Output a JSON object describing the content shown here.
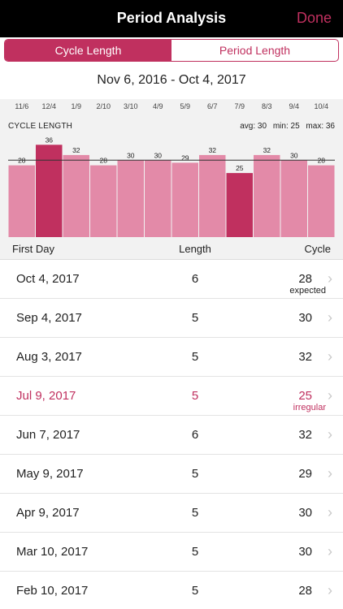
{
  "nav": {
    "title": "Period Analysis",
    "done_label": "Done"
  },
  "tabs": [
    {
      "label": "Cycle Length",
      "active": true
    },
    {
      "label": "Period Length",
      "active": false
    }
  ],
  "date_range": "Nov 6, 2016 - Oct 4, 2017",
  "chart_data": {
    "type": "bar",
    "title": "CYCLE LENGTH",
    "stats": {
      "avg": "avg: 30",
      "min": "min: 25",
      "max": "max: 36"
    },
    "average": 30,
    "categories": [
      "11/6",
      "12/4",
      "1/9",
      "2/10",
      "3/10",
      "4/9",
      "5/9",
      "6/7",
      "7/9",
      "8/3",
      "9/4",
      "10/4"
    ],
    "values": [
      28,
      36,
      32,
      28,
      30,
      30,
      29,
      32,
      25,
      32,
      30,
      28
    ],
    "highlighted": [
      1,
      8
    ],
    "colors": {
      "normal": "#e38aa8",
      "highlight": "#c0305f",
      "average_line": "#333333"
    }
  },
  "list_header": {
    "first_day": "First Day",
    "length": "Length",
    "cycle": "Cycle"
  },
  "rows": [
    {
      "date": "Oct 4, 2017",
      "length": "6",
      "cycle": "28",
      "note": "expected",
      "highlight": false
    },
    {
      "date": "Sep 4, 2017",
      "length": "5",
      "cycle": "30",
      "note": "",
      "highlight": false
    },
    {
      "date": "Aug 3, 2017",
      "length": "5",
      "cycle": "32",
      "note": "",
      "highlight": false
    },
    {
      "date": "Jul 9, 2017",
      "length": "5",
      "cycle": "25",
      "note": "irregular",
      "highlight": true
    },
    {
      "date": "Jun 7, 2017",
      "length": "6",
      "cycle": "32",
      "note": "",
      "highlight": false
    },
    {
      "date": "May 9, 2017",
      "length": "5",
      "cycle": "29",
      "note": "",
      "highlight": false
    },
    {
      "date": "Apr 9, 2017",
      "length": "5",
      "cycle": "30",
      "note": "",
      "highlight": false
    },
    {
      "date": "Mar 10, 2017",
      "length": "5",
      "cycle": "30",
      "note": "",
      "highlight": false
    },
    {
      "date": "Feb 10, 2017",
      "length": "5",
      "cycle": "28",
      "note": "",
      "highlight": false
    }
  ]
}
